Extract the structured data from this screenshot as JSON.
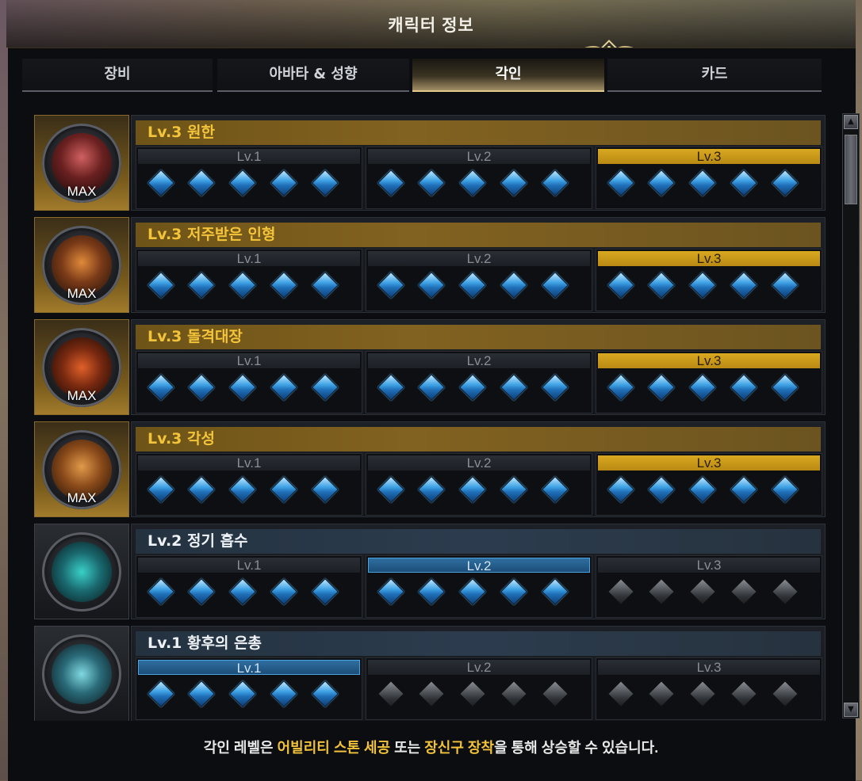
{
  "window": {
    "title": "캐릭터 정보",
    "colors": {
      "gold": "#f3c43a",
      "blue_gem": "#3fa2e4",
      "active_blue": "#2f6ea0"
    }
  },
  "tabs": [
    {
      "label": "장비",
      "active": false
    },
    {
      "label": "아바타 & 성향",
      "active": false
    },
    {
      "label": "각인",
      "active": true
    },
    {
      "label": "카드",
      "active": false
    }
  ],
  "engravings": [
    {
      "name": "Lv.3 원한",
      "max_label": "MAX",
      "level": 3,
      "icon": "wolf-portrait-icon",
      "levels": [
        {
          "label": "Lv.1"
        },
        {
          "label": "Lv.2"
        },
        {
          "label": "Lv.3"
        }
      ]
    },
    {
      "name": "Lv.3 저주받은 인형",
      "max_label": "MAX",
      "level": 3,
      "icon": "cursed-doll-portrait-icon",
      "levels": [
        {
          "label": "Lv.1"
        },
        {
          "label": "Lv.2"
        },
        {
          "label": "Lv.3"
        }
      ]
    },
    {
      "name": "Lv.3 돌격대장",
      "max_label": "MAX",
      "level": 3,
      "icon": "charge-squad-icon",
      "levels": [
        {
          "label": "Lv.1"
        },
        {
          "label": "Lv.2"
        },
        {
          "label": "Lv.3"
        }
      ]
    },
    {
      "name": "Lv.3 각성",
      "max_label": "MAX",
      "level": 3,
      "icon": "awakening-portrait-icon",
      "levels": [
        {
          "label": "Lv.1"
        },
        {
          "label": "Lv.2"
        },
        {
          "label": "Lv.3"
        }
      ]
    },
    {
      "name": "Lv.2 정기 흡수",
      "max_label": "",
      "level": 2,
      "icon": "spirit-absorption-icon",
      "levels": [
        {
          "label": "Lv.1"
        },
        {
          "label": "Lv.2"
        },
        {
          "label": "Lv.3"
        }
      ]
    },
    {
      "name": "Lv.1 황후의 은총",
      "max_label": "",
      "level": 1,
      "icon": "empress-grace-icon",
      "levels": [
        {
          "label": "Lv.1"
        },
        {
          "label": "Lv.2"
        },
        {
          "label": "Lv.3"
        }
      ]
    }
  ],
  "footer": {
    "part1": "각인 레벨은 ",
    "highlight1": "어빌리티 스톤 세공",
    "part2": " 또는 ",
    "highlight2": "장신구 장착",
    "part3": "을 통해 상승할 수 있습니다."
  }
}
